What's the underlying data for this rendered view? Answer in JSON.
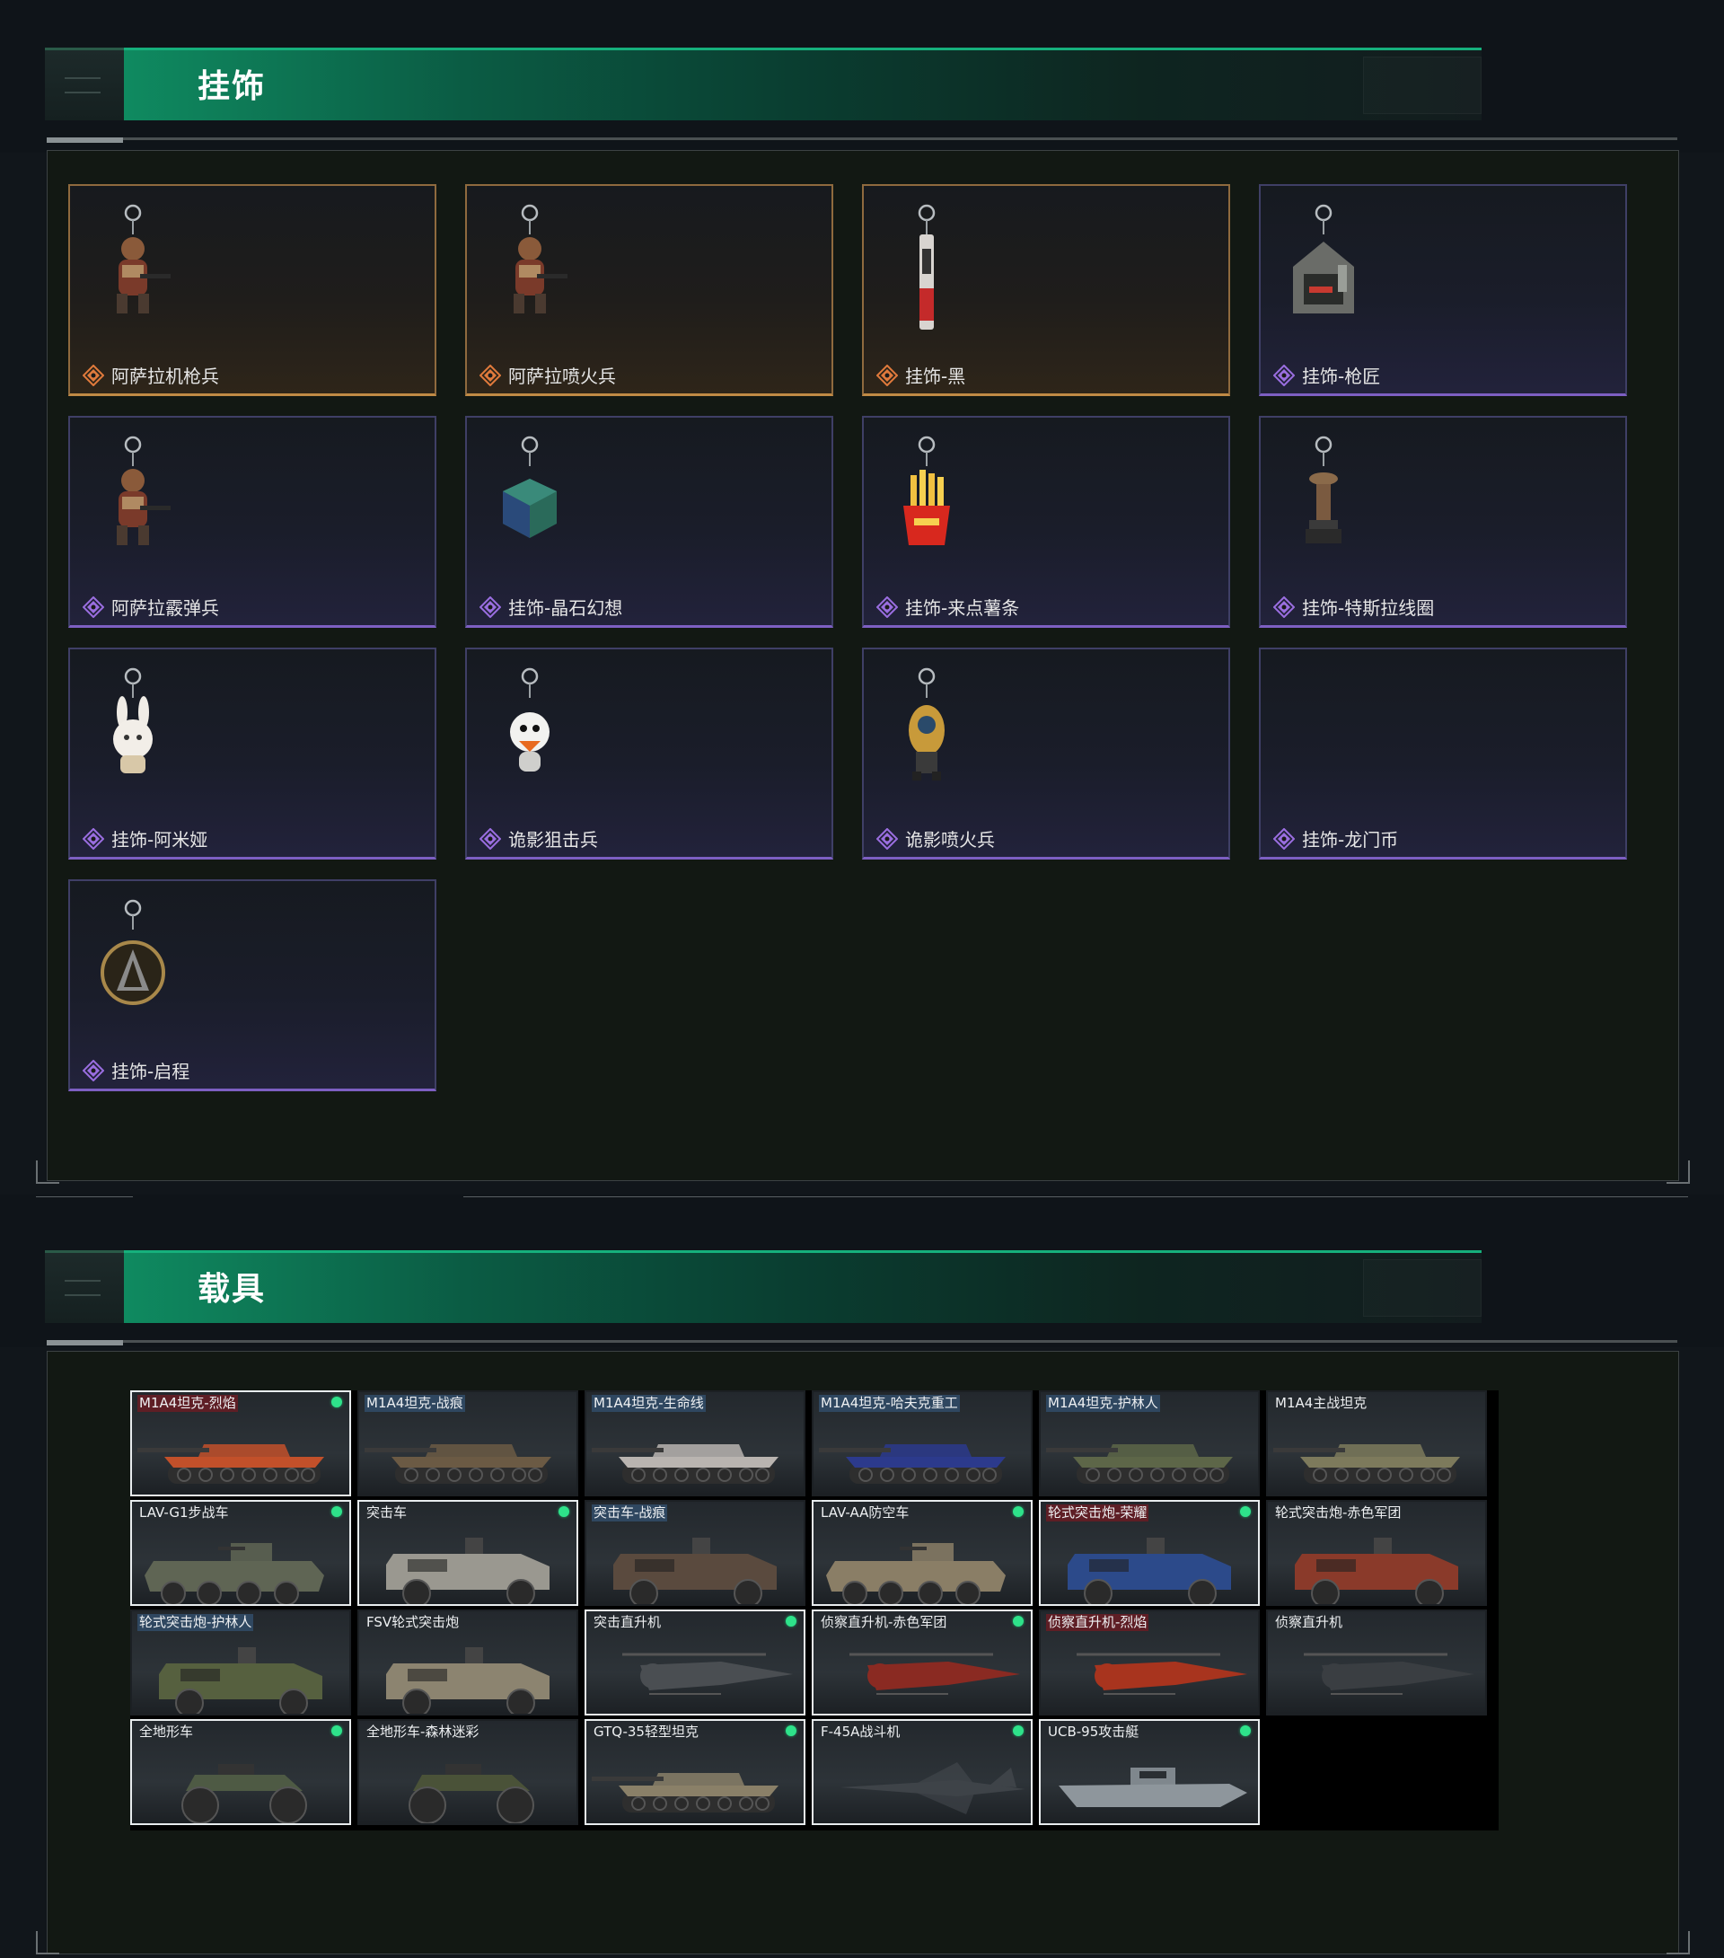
{
  "sections": {
    "pendants": {
      "title": "挂饰"
    },
    "vehicles": {
      "title": "载具"
    }
  },
  "colors": {
    "accent_green": "#16b07c",
    "rarity_gold": "#e07a3c",
    "rarity_purple": "#9a6ee0",
    "owned_dot": "#2ee28a"
  },
  "pendants": [
    {
      "name": "阿萨拉机枪兵",
      "rarity": "gold",
      "icon": "soldier-pendant-icon"
    },
    {
      "name": "阿萨拉喷火兵",
      "rarity": "gold",
      "icon": "soldier-pendant-icon"
    },
    {
      "name": "挂饰-黑",
      "rarity": "gold",
      "icon": "knife-pendant-icon"
    },
    {
      "name": "挂饰-枪匠",
      "rarity": "purple",
      "icon": "toolbox-pendant-icon"
    },
    {
      "name": "阿萨拉霰弹兵",
      "rarity": "purple",
      "icon": "soldier-pendant-icon"
    },
    {
      "name": "挂饰-晶石幻想",
      "rarity": "purple",
      "icon": "cube-pendant-icon"
    },
    {
      "name": "挂饰-来点薯条",
      "rarity": "purple",
      "icon": "fries-pendant-icon"
    },
    {
      "name": "挂饰-特斯拉线圈",
      "rarity": "purple",
      "icon": "tesla-coil-pendant-icon"
    },
    {
      "name": "挂饰-阿米娅",
      "rarity": "purple",
      "icon": "rabbit-pendant-icon"
    },
    {
      "name": "诡影狙击兵",
      "rarity": "purple",
      "icon": "duck-pendant-icon"
    },
    {
      "name": "诡影喷火兵",
      "rarity": "purple",
      "icon": "flame-soldier-pendant-icon"
    },
    {
      "name": "挂饰-龙门币",
      "rarity": "purple",
      "icon": "coin-pendant-icon"
    },
    {
      "name": "挂饰-启程",
      "rarity": "purple",
      "icon": "medal-pendant-icon"
    }
  ],
  "vehicles": [
    {
      "name": "M1A4坦克-烈焰",
      "owned": true,
      "tag": "red",
      "type": "tank",
      "skin": "#c2502a"
    },
    {
      "name": "M1A4坦克-战痕",
      "owned": false,
      "tag": "blue",
      "type": "tank",
      "skin": "#6b5a44"
    },
    {
      "name": "M1A4坦克-生命线",
      "owned": false,
      "tag": "blue",
      "type": "tank",
      "skin": "#b9b4b0"
    },
    {
      "name": "M1A4坦克-哈夫克重工",
      "owned": false,
      "tag": "blue",
      "type": "tank",
      "skin": "#2c3a8c"
    },
    {
      "name": "M1A4坦克-护林人",
      "owned": false,
      "tag": "blue",
      "type": "tank",
      "skin": "#5d6648"
    },
    {
      "name": "M1A4主战坦克",
      "owned": false,
      "tag": "plain",
      "type": "tank",
      "skin": "#7d7a5c"
    },
    {
      "name": "LAV-G1步战车",
      "owned": true,
      "tag": "plain",
      "type": "apc",
      "skin": "#5f6554"
    },
    {
      "name": "突击车",
      "owned": true,
      "tag": "plain",
      "type": "truck",
      "skin": "#9a9890"
    },
    {
      "name": "突击车-战痕",
      "owned": false,
      "tag": "blue",
      "type": "truck",
      "skin": "#5a4a3e"
    },
    {
      "name": "LAV-AA防空车",
      "owned": true,
      "tag": "plain",
      "type": "apc",
      "skin": "#8a7e66"
    },
    {
      "name": "轮式突击炮-荣耀",
      "owned": true,
      "tag": "red",
      "type": "truck",
      "skin": "#2c4a8a"
    },
    {
      "name": "轮式突击炮-赤色军团",
      "owned": false,
      "tag": "plain",
      "type": "truck",
      "skin": "#8a3a2a"
    },
    {
      "name": "轮式突击炮-护林人",
      "owned": false,
      "tag": "blue",
      "type": "truck",
      "skin": "#56603f"
    },
    {
      "name": "FSV轮式突击炮",
      "owned": false,
      "tag": "plain",
      "type": "truck",
      "skin": "#8c8470"
    },
    {
      "name": "突击直升机",
      "owned": true,
      "tag": "plain",
      "type": "heli",
      "skin": "#4a4e52"
    },
    {
      "name": "侦察直升机-赤色军团",
      "owned": true,
      "tag": "plain",
      "type": "heli",
      "skin": "#8a2a22"
    },
    {
      "name": "侦察直升机-烈焰",
      "owned": false,
      "tag": "red",
      "type": "heli",
      "skin": "#a8341e"
    },
    {
      "name": "侦察直升机",
      "owned": false,
      "tag": "plain",
      "type": "heli",
      "skin": "#3a3e42"
    },
    {
      "name": "全地形车",
      "owned": true,
      "tag": "plain",
      "type": "atv",
      "skin": "#4e5a44"
    },
    {
      "name": "全地形车-森林迷彩",
      "owned": false,
      "tag": "plain",
      "type": "atv",
      "skin": "#4a5238"
    },
    {
      "name": "GTQ-35轻型坦克",
      "owned": true,
      "tag": "plain",
      "type": "tank",
      "skin": "#8a8068"
    },
    {
      "name": "F-45A战斗机",
      "owned": true,
      "tag": "plain",
      "type": "jet",
      "skin": "#3e4348"
    },
    {
      "name": "UCB-95攻击艇",
      "owned": true,
      "tag": "plain",
      "type": "boat",
      "skin": "#8e969c"
    }
  ]
}
